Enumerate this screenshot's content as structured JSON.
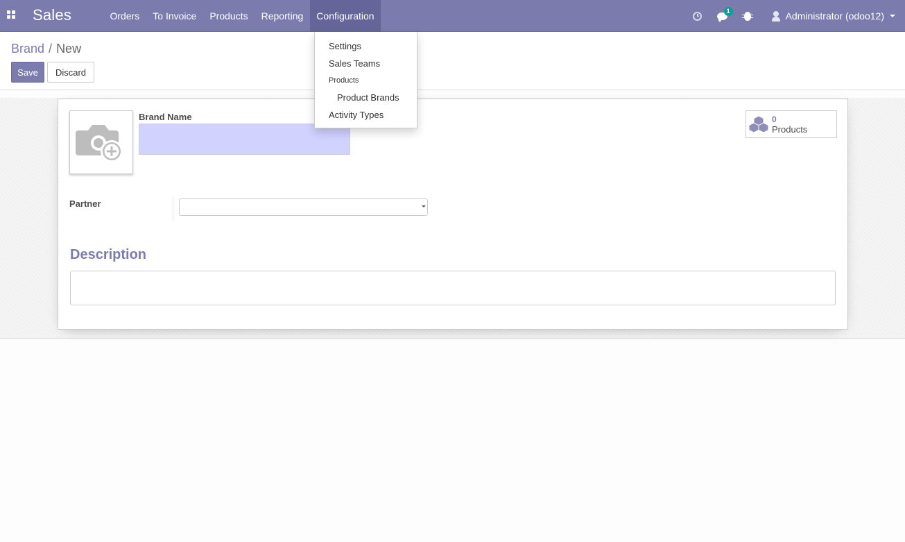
{
  "navbar": {
    "app_name": "Sales",
    "menu": [
      "Orders",
      "To Invoice",
      "Products",
      "Reporting",
      "Configuration"
    ],
    "active_menu": "Configuration",
    "chat_badge": "1",
    "user_name": "Administrator (odoo12)",
    "icons": [
      "apps-grid-icon",
      "clock-icon",
      "chat-icon",
      "bug-icon",
      "user-icon"
    ]
  },
  "breadcrumb": {
    "parent": "Brand",
    "separator": "/",
    "current": "New"
  },
  "buttons": {
    "save": "Save",
    "discard": "Discard"
  },
  "form": {
    "brand_name_label": "Brand Name",
    "brand_name_value": "",
    "partner_label": "Partner",
    "partner_value": "",
    "description_title": "Description",
    "description_value": ""
  },
  "smart_button": {
    "value": "0",
    "label": "Products"
  },
  "dropdown": {
    "items": [
      {
        "label": "Settings",
        "type": "item"
      },
      {
        "label": "Sales Teams",
        "type": "item"
      },
      {
        "label": "Products",
        "type": "header"
      },
      {
        "label": "Product Brands",
        "type": "subitem"
      },
      {
        "label": "Activity Types",
        "type": "item"
      }
    ]
  },
  "colors": {
    "brand": "#7c7bad",
    "active_menu": "#66659a",
    "badge": "#00a09d",
    "required_field": "#d2d2ff"
  }
}
